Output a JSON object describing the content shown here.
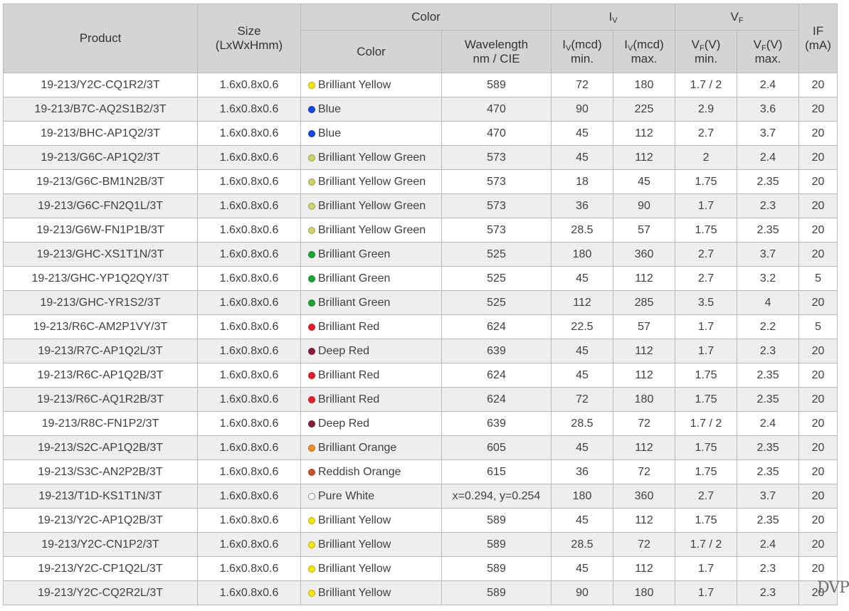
{
  "headers": {
    "product": "Product",
    "size": "Size",
    "size_unit": "(LxWxHmm)",
    "color_group": "Color",
    "color": "Color",
    "wavelength": "Wavelength",
    "wavelength_unit": "nm / CIE",
    "iv_group": "I",
    "iv_group_sub": "V",
    "iv_sym": "I",
    "iv_sub": "V",
    "iv_unit": "(mcd)",
    "min": "min.",
    "max": "max.",
    "vf_group": "V",
    "vf_group_sub": "F",
    "vf_sym": "V",
    "vf_sub": "F",
    "vf_unit": "(V)",
    "if_sym": "IF",
    "if_unit": "(mA)"
  },
  "color_swatches": {
    "Brilliant Yellow": "#f7e600",
    "Blue": "#1448e6",
    "Brilliant Yellow Green": "#cdd36a",
    "Brilliant Green": "#19a832",
    "Brilliant Red": "#ee1c24",
    "Deep Red": "#8b1f3b",
    "Brilliant Orange": "#f7901e",
    "Reddish Orange": "#c8542a",
    "Pure White": "#ffffff"
  },
  "rows": [
    {
      "product": "19-213/Y2C-CQ1R2/3T",
      "size": "1.6x0.8x0.6",
      "color": "Brilliant Yellow",
      "wavelength": "589",
      "iv_min": "72",
      "iv_max": "180",
      "vf_min": "1.7 / 2",
      "vf_max": "2.4",
      "if": "20"
    },
    {
      "product": "19-213/B7C-AQ2S1B2/3T",
      "size": "1.6x0.8x0.6",
      "color": "Blue",
      "wavelength": "470",
      "iv_min": "90",
      "iv_max": "225",
      "vf_min": "2.9",
      "vf_max": "3.6",
      "if": "20"
    },
    {
      "product": "19-213/BHC-AP1Q2/3T",
      "size": "1.6x0.8x0.6",
      "color": "Blue",
      "wavelength": "470",
      "iv_min": "45",
      "iv_max": "112",
      "vf_min": "2.7",
      "vf_max": "3.7",
      "if": "20"
    },
    {
      "product": "19-213/G6C-AP1Q2/3T",
      "size": "1.6x0.8x0.6",
      "color": "Brilliant Yellow Green",
      "wavelength": "573",
      "iv_min": "45",
      "iv_max": "112",
      "vf_min": "2",
      "vf_max": "2.4",
      "if": "20"
    },
    {
      "product": "19-213/G6C-BM1N2B/3T",
      "size": "1.6x0.8x0.6",
      "color": "Brilliant Yellow Green",
      "wavelength": "573",
      "iv_min": "18",
      "iv_max": "45",
      "vf_min": "1.75",
      "vf_max": "2.35",
      "if": "20"
    },
    {
      "product": "19-213/G6C-FN2Q1L/3T",
      "size": "1.6x0.8x0.6",
      "color": "Brilliant Yellow Green",
      "wavelength": "573",
      "iv_min": "36",
      "iv_max": "90",
      "vf_min": "1.7",
      "vf_max": "2.3",
      "if": "20"
    },
    {
      "product": "19-213/G6W-FN1P1B/3T",
      "size": "1.6x0.8x0.6",
      "color": "Brilliant Yellow Green",
      "wavelength": "573",
      "iv_min": "28.5",
      "iv_max": "57",
      "vf_min": "1.75",
      "vf_max": "2.35",
      "if": "20"
    },
    {
      "product": "19-213/GHC-XS1T1N/3T",
      "size": "1.6x0.8x0.6",
      "color": "Brilliant Green",
      "wavelength": "525",
      "iv_min": "180",
      "iv_max": "360",
      "vf_min": "2.7",
      "vf_max": "3.7",
      "if": "20"
    },
    {
      "product": "19-213/GHC-YP1Q2QY/3T",
      "size": "1.6x0.8x0.6",
      "color": "Brilliant Green",
      "wavelength": "525",
      "iv_min": "45",
      "iv_max": "112",
      "vf_min": "2.7",
      "vf_max": "3.2",
      "if": "5"
    },
    {
      "product": "19-213/GHC-YR1S2/3T",
      "size": "1.6x0.8x0.6",
      "color": "Brilliant Green",
      "wavelength": "525",
      "iv_min": "112",
      "iv_max": "285",
      "vf_min": "3.5",
      "vf_max": "4",
      "if": "20"
    },
    {
      "product": "19-213/R6C-AM2P1VY/3T",
      "size": "1.6x0.8x0.6",
      "color": "Brilliant Red",
      "wavelength": "624",
      "iv_min": "22.5",
      "iv_max": "57",
      "vf_min": "1.7",
      "vf_max": "2.2",
      "if": "5"
    },
    {
      "product": "19-213/R7C-AP1Q2L/3T",
      "size": "1.6x0.8x0.6",
      "color": "Deep Red",
      "wavelength": "639",
      "iv_min": "45",
      "iv_max": "112",
      "vf_min": "1.7",
      "vf_max": "2.3",
      "if": "20"
    },
    {
      "product": "19-213/R6C-AP1Q2B/3T",
      "size": "1.6x0.8x0.6",
      "color": "Brilliant Red",
      "wavelength": "624",
      "iv_min": "45",
      "iv_max": "112",
      "vf_min": "1.75",
      "vf_max": "2.35",
      "if": "20"
    },
    {
      "product": "19-213/R6C-AQ1R2B/3T",
      "size": "1.6x0.8x0.6",
      "color": "Brilliant Red",
      "wavelength": "624",
      "iv_min": "72",
      "iv_max": "180",
      "vf_min": "1.75",
      "vf_max": "2.35",
      "if": "20"
    },
    {
      "product": "19-213/R8C-FN1P2/3T",
      "size": "1.6x0.8x0.6",
      "color": "Deep Red",
      "wavelength": "639",
      "iv_min": "28.5",
      "iv_max": "72",
      "vf_min": "1.7 / 2",
      "vf_max": "2.4",
      "if": "20"
    },
    {
      "product": "19-213/S2C-AP1Q2B/3T",
      "size": "1.6x0.8x0.6",
      "color": "Brilliant Orange",
      "wavelength": "605",
      "iv_min": "45",
      "iv_max": "112",
      "vf_min": "1.75",
      "vf_max": "2.35",
      "if": "20"
    },
    {
      "product": "19-213/S3C-AN2P2B/3T",
      "size": "1.6x0.8x0.6",
      "color": "Reddish Orange",
      "wavelength": "615",
      "iv_min": "36",
      "iv_max": "72",
      "vf_min": "1.75",
      "vf_max": "2.35",
      "if": "20"
    },
    {
      "product": "19-213/T1D-KS1T1N/3T",
      "size": "1.6x0.8x0.6",
      "color": "Pure White",
      "wavelength": "x=0.294, y=0.254",
      "iv_min": "180",
      "iv_max": "360",
      "vf_min": "2.7",
      "vf_max": "3.7",
      "if": "20"
    },
    {
      "product": "19-213/Y2C-AP1Q2B/3T",
      "size": "1.6x0.8x0.6",
      "color": "Brilliant Yellow",
      "wavelength": "589",
      "iv_min": "45",
      "iv_max": "112",
      "vf_min": "1.75",
      "vf_max": "2.35",
      "if": "20"
    },
    {
      "product": "19-213/Y2C-CN1P2/3T",
      "size": "1.6x0.8x0.6",
      "color": "Brilliant Yellow",
      "wavelength": "589",
      "iv_min": "28.5",
      "iv_max": "72",
      "vf_min": "1.7 / 2",
      "vf_max": "2.4",
      "if": "20"
    },
    {
      "product": "19-213/Y2C-CP1Q2L/3T",
      "size": "1.6x0.8x0.6",
      "color": "Brilliant Yellow",
      "wavelength": "589",
      "iv_min": "45",
      "iv_max": "112",
      "vf_min": "1.7",
      "vf_max": "2.3",
      "if": "20"
    },
    {
      "product": "19-213/Y2C-CQ2R2L/3T",
      "size": "1.6x0.8x0.6",
      "color": "Brilliant Yellow",
      "wavelength": "589",
      "iv_min": "90",
      "iv_max": "180",
      "vf_min": "1.7",
      "vf_max": "2.3",
      "if": "20"
    }
  ],
  "watermark": "DVP"
}
